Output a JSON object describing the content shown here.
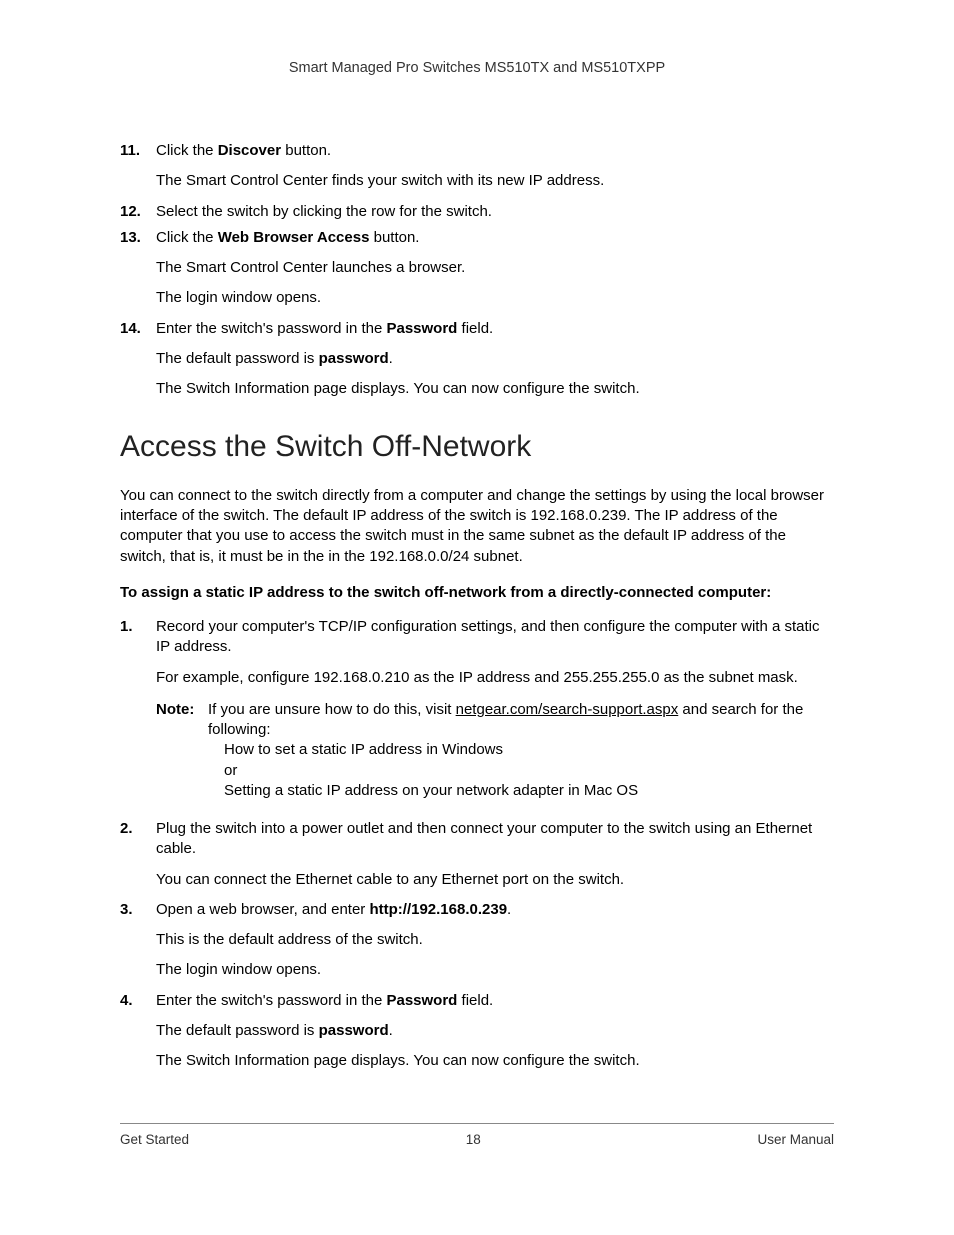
{
  "header": {
    "title": "Smart Managed Pro Switches MS510TX and MS510TXPP"
  },
  "list1": {
    "items": [
      {
        "num": "11.",
        "line_pre": "Click the ",
        "line_bold": "Discover",
        "line_post": " button.",
        "subs": [
          "The Smart Control Center finds your switch with its new IP address."
        ]
      },
      {
        "num": "12.",
        "line_pre": "Select the switch by clicking the row for the switch.",
        "line_bold": "",
        "line_post": "",
        "subs": []
      },
      {
        "num": "13.",
        "line_pre": "Click the ",
        "line_bold": "Web Browser Access",
        "line_post": " button.",
        "subs": [
          "The Smart Control Center launches a browser.",
          "The login window opens."
        ]
      },
      {
        "num": "14.",
        "line_pre": "Enter the switch's password in the ",
        "line_bold": "Password",
        "line_post": " field.",
        "subs_pw": {
          "pre": "The default password is ",
          "bold": "password",
          "post": "."
        },
        "subs2": "The Switch Information page displays. You can now configure the switch."
      }
    ]
  },
  "section": {
    "title": "Access the Switch Off-Network",
    "intro": "You can connect to the switch directly from a computer and change the settings by using the local browser interface of the switch. The default IP address of the switch is 192.168.0.239. The IP address of the computer that you use to access the switch must in the same subnet as the default IP address of the switch, that is, it must be in the in the 192.168.0.0/24 subnet.",
    "task": "To assign a static IP address to the switch off-network from a directly-connected computer:"
  },
  "list2": {
    "items": [
      {
        "num": "1.",
        "line": "Record your computer's TCP/IP configuration settings, and then configure the computer with a static IP address.",
        "sub1": "For example, configure 192.168.0.210 as the IP address and 255.255.255.0 as the subnet mask.",
        "note": {
          "label": "Note:",
          "l1": "If you are unsure how to do this, visit ",
          "link_text": "netgear.com/search-support.aspx",
          "l1b": " and search for the following:",
          "l2": "How to set a static IP address in Windows",
          "l3": "or",
          "l4": "Setting a static IP address on your network adapter in Mac OS"
        }
      },
      {
        "num": "2.",
        "line": "Plug the switch into a power outlet and then connect your computer to the switch using an Ethernet cable.",
        "sub1": "You can connect the Ethernet cable to any Ethernet port on the switch."
      },
      {
        "num": "3.",
        "line_pre": "Open a web browser, and enter ",
        "line_bold": "http://192.168.0.239",
        "line_post": ".",
        "sub1": "This is the default address of the switch.",
        "sub2": "The login window opens."
      },
      {
        "num": "4.",
        "line_pre": "Enter the switch's password in the ",
        "line_bold": "Password",
        "line_post": " field.",
        "sub_pw": {
          "pre": "The default password is ",
          "bold": "password",
          "post": "."
        },
        "sub2": "The Switch Information page displays. You can now configure the switch."
      }
    ]
  },
  "footer": {
    "left": "Get Started",
    "center": "18",
    "right": "User Manual"
  }
}
